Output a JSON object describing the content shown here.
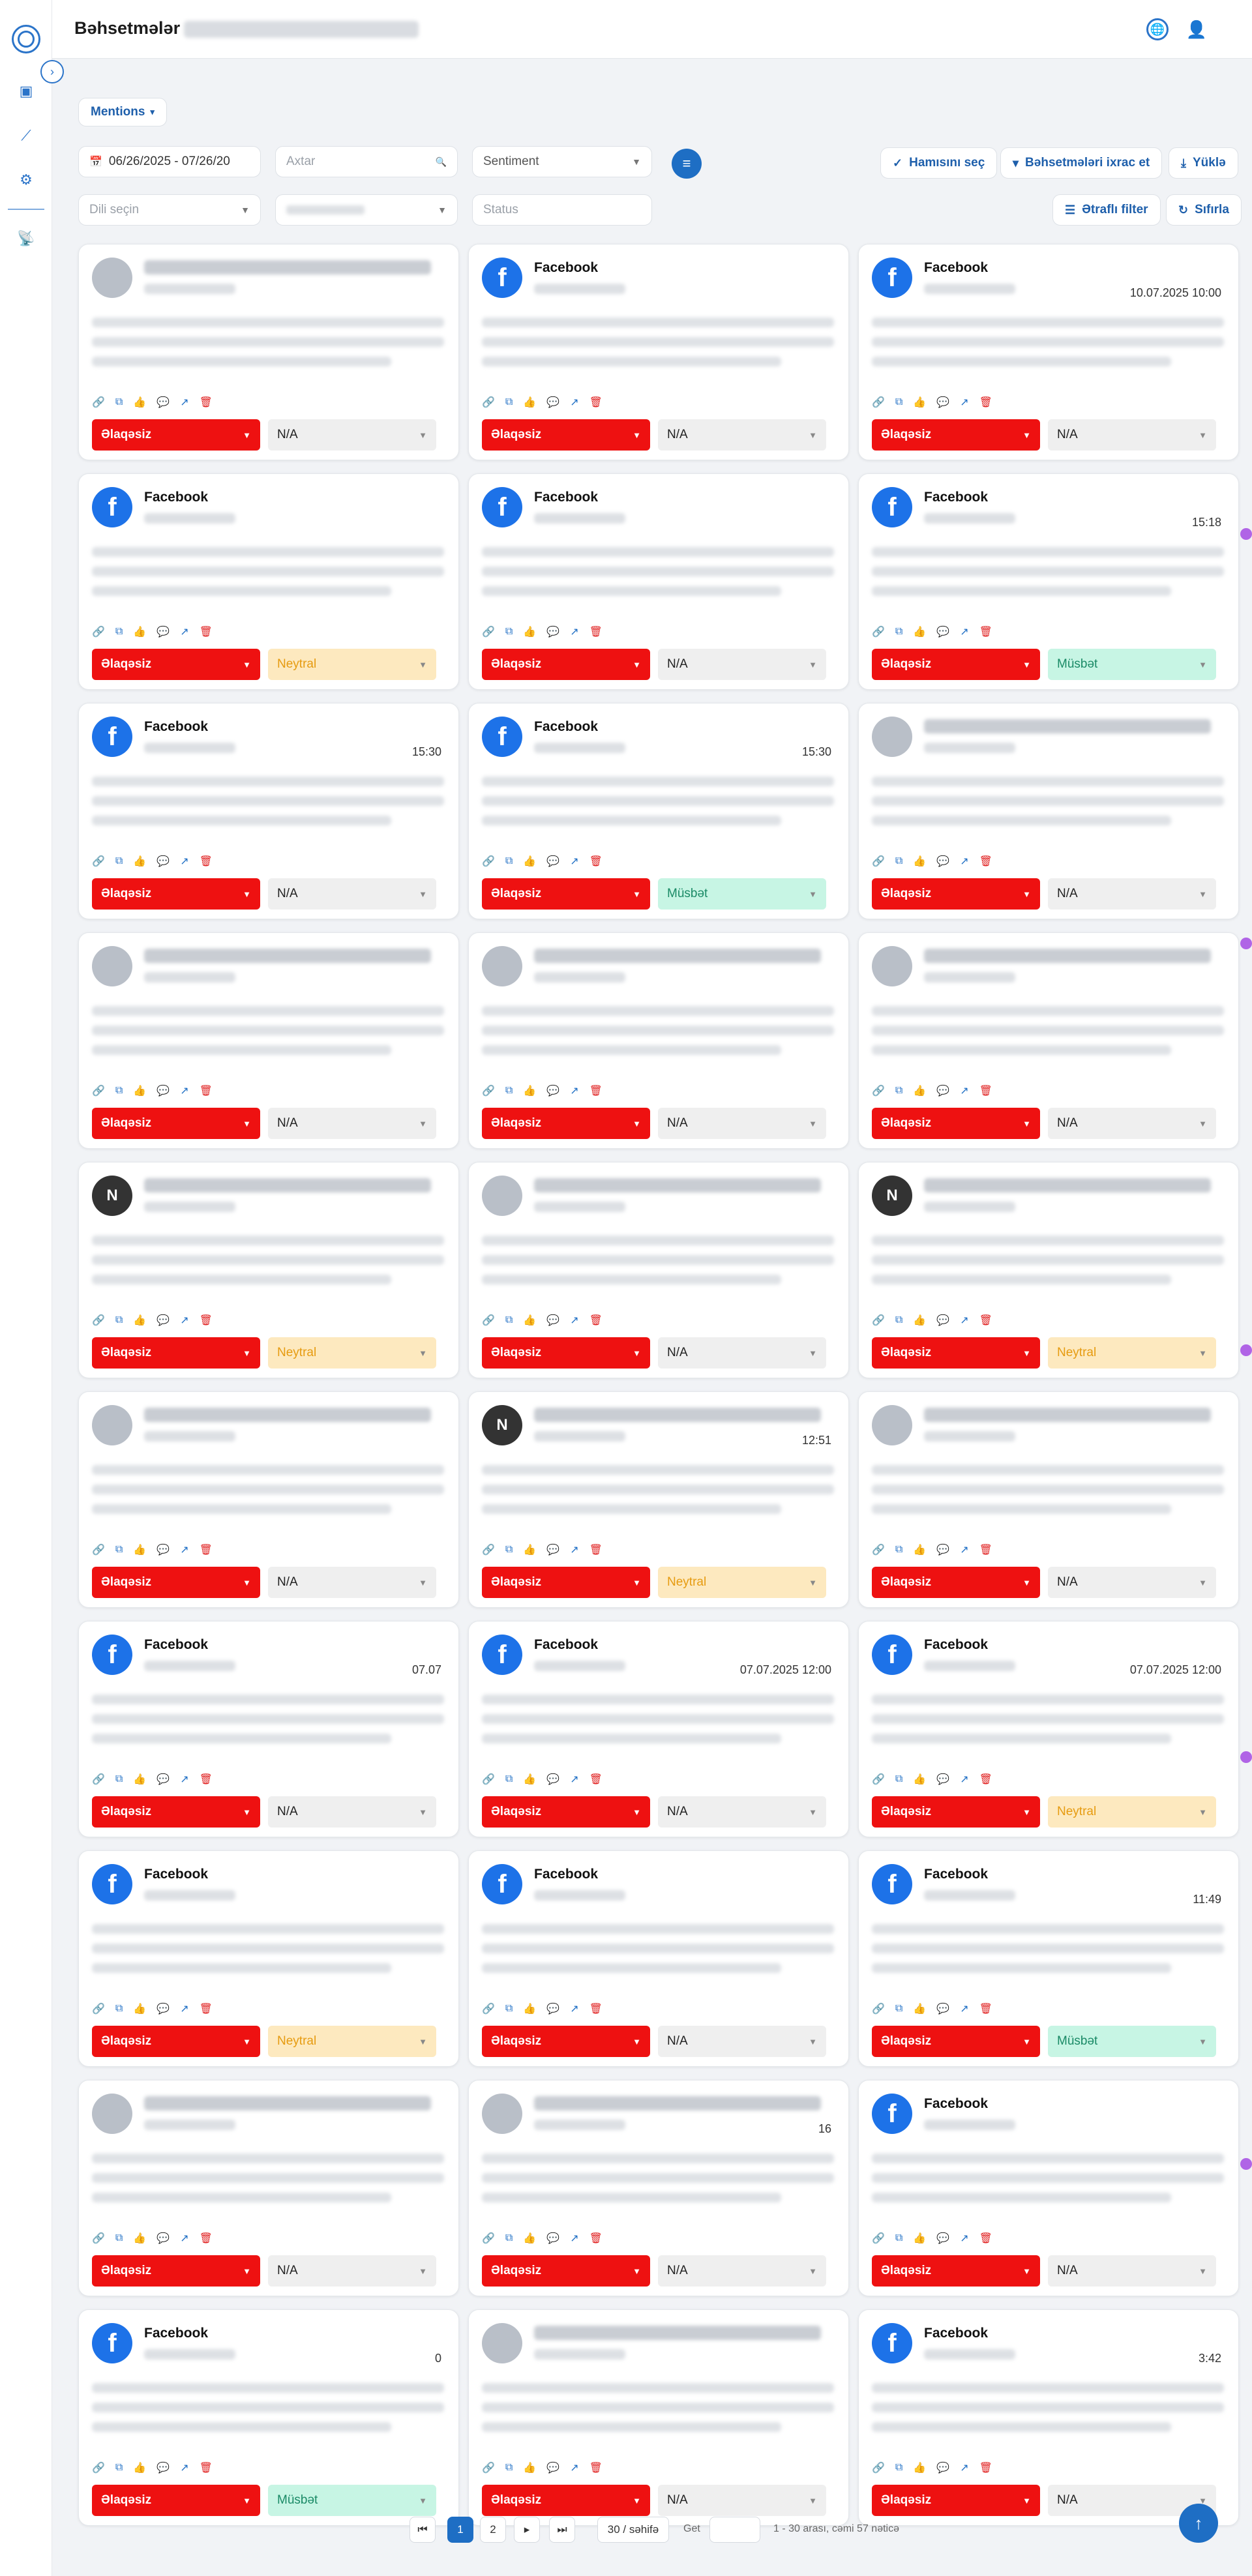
{
  "header": {
    "title": "Bəhsetmələr"
  },
  "filters": {
    "tab": "Mentions",
    "date_range": "06/26/2025 - 07/26/20",
    "search_placeholder": "Axtar",
    "sentiment_placeholder": "Sentiment",
    "language_placeholder": "Dili seçin",
    "status_placeholder": "Status",
    "select_all": "Hamısını seç",
    "export": "Bəhsetmələri ixrac et",
    "download": "Yüklə",
    "advanced": "Ətraflı filter",
    "reset": "Sıfırla"
  },
  "relevance_label": "Əlaqəsiz",
  "cards": [
    {
      "source": "",
      "date": "",
      "sentiment": "N/A",
      "icon": "photo"
    },
    {
      "source": "Facebook",
      "date": "",
      "sentiment": "N/A",
      "icon": "facebook"
    },
    {
      "source": "Facebook",
      "date": "10.07.2025 10:00",
      "sentiment": "N/A",
      "icon": "facebook"
    },
    {
      "source": "Facebook",
      "date": "",
      "sentiment": "Neytral",
      "icon": "facebook"
    },
    {
      "source": "Facebook",
      "date": "",
      "sentiment": "N/A",
      "icon": "facebook"
    },
    {
      "source": "Facebook",
      "date": "15:18",
      "sentiment": "Müsbət",
      "icon": "facebook"
    },
    {
      "source": "Facebook",
      "date": "15:30",
      "sentiment": "N/A",
      "icon": "facebook"
    },
    {
      "source": "Facebook",
      "date": "15:30",
      "sentiment": "Müsbət",
      "icon": "facebook"
    },
    {
      "source": "",
      "date": "",
      "sentiment": "N/A",
      "icon": "photo"
    },
    {
      "source": "",
      "date": "",
      "sentiment": "N/A",
      "icon": "photo"
    },
    {
      "source": "",
      "date": "",
      "sentiment": "N/A",
      "icon": "photo"
    },
    {
      "source": "",
      "date": "",
      "sentiment": "N/A",
      "icon": "photo"
    },
    {
      "source": "",
      "date": "",
      "sentiment": "Neytral",
      "icon": "news"
    },
    {
      "source": "",
      "date": "",
      "sentiment": "N/A",
      "icon": "photo"
    },
    {
      "source": "",
      "date": "",
      "sentiment": "Neytral",
      "icon": "news"
    },
    {
      "source": "",
      "date": "",
      "sentiment": "N/A",
      "icon": "photo"
    },
    {
      "source": "",
      "date": "12:51",
      "sentiment": "Neytral",
      "icon": "news"
    },
    {
      "source": "",
      "date": "",
      "sentiment": "N/A",
      "icon": "photo"
    },
    {
      "source": "Facebook",
      "date": "07.07",
      "sentiment": "N/A",
      "icon": "facebook"
    },
    {
      "source": "Facebook",
      "date": "07.07.2025 12:00",
      "sentiment": "N/A",
      "icon": "facebook"
    },
    {
      "source": "Facebook",
      "date": "07.07.2025 12:00",
      "sentiment": "Neytral",
      "icon": "facebook"
    },
    {
      "source": "Facebook",
      "date": "",
      "sentiment": "Neytral",
      "icon": "facebook"
    },
    {
      "source": "Facebook",
      "date": "",
      "sentiment": "N/A",
      "icon": "facebook"
    },
    {
      "source": "Facebook",
      "date": "11:49",
      "sentiment": "Müsbət",
      "icon": "facebook"
    },
    {
      "source": "",
      "date": "",
      "sentiment": "N/A",
      "icon": "photo"
    },
    {
      "source": "",
      "date": "16",
      "sentiment": "N/A",
      "icon": "photo"
    },
    {
      "source": "Facebook",
      "date": "",
      "sentiment": "N/A",
      "icon": "facebook"
    },
    {
      "source": "Facebook",
      "date": "0",
      "sentiment": "Müsbət",
      "icon": "facebook"
    },
    {
      "source": "",
      "date": "",
      "sentiment": "N/A",
      "icon": "photo"
    },
    {
      "source": "Facebook",
      "date": "3:42",
      "sentiment": "N/A",
      "icon": "facebook"
    }
  ],
  "pagination": {
    "first": "⏮",
    "prev": "",
    "page1": "1",
    "page2": "2",
    "next": "",
    "last": "⏭",
    "per_page": "30 / səhifə",
    "goto": "Get",
    "summary": "1 - 30 arası, cəmi 57 nəticə"
  }
}
